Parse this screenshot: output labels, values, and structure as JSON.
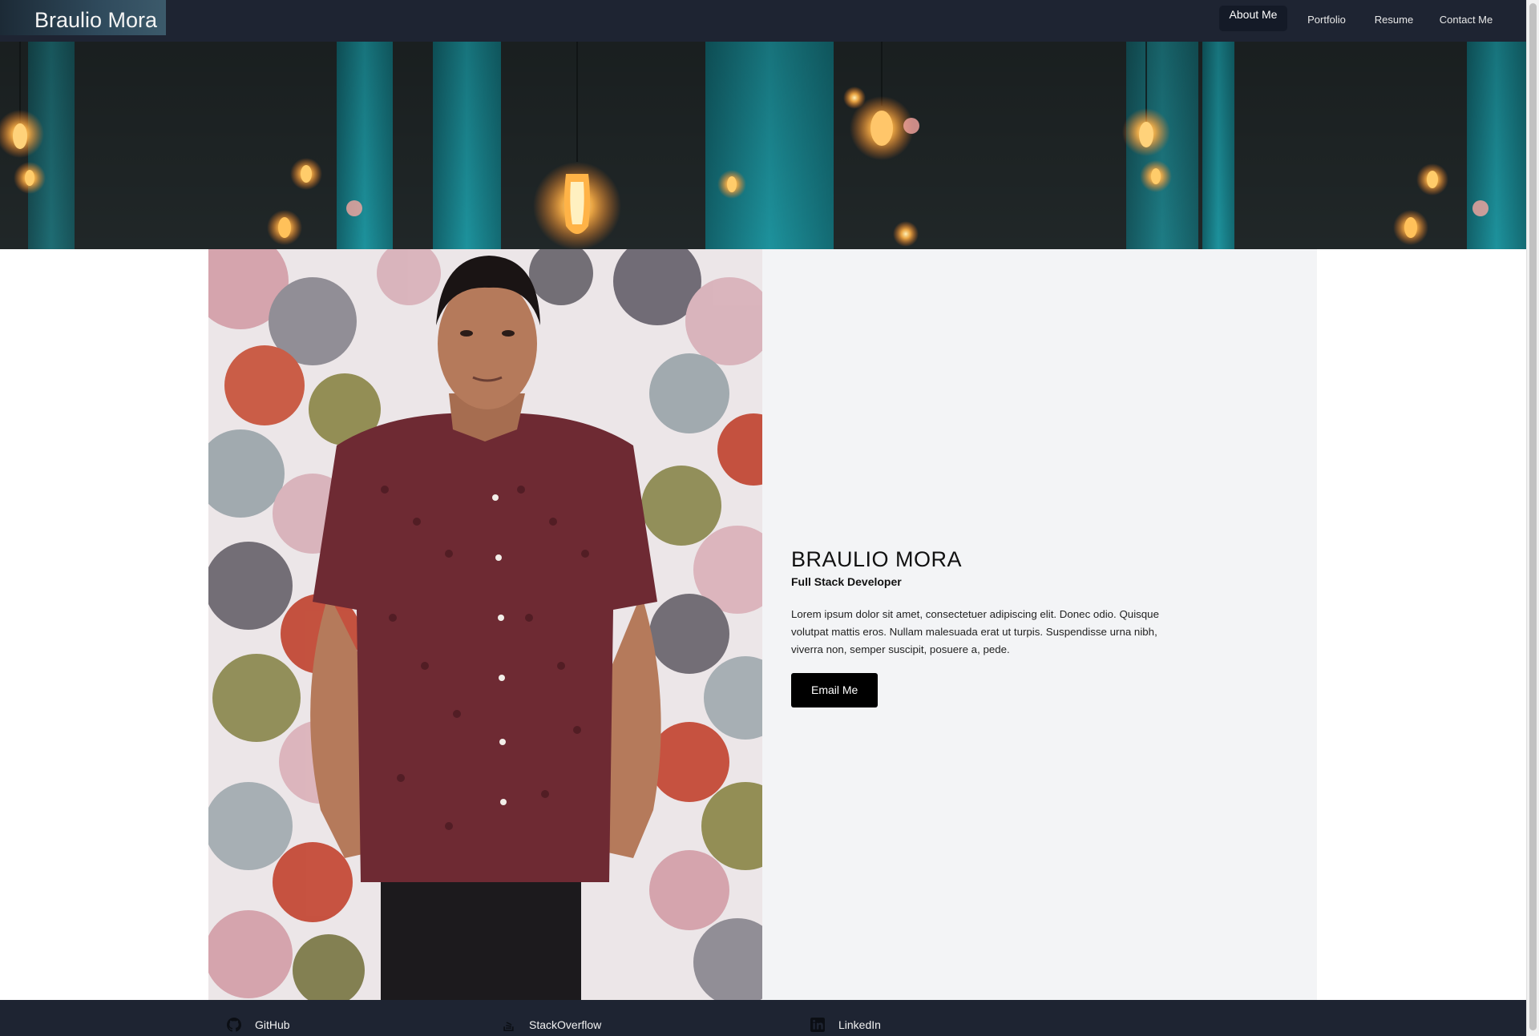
{
  "header": {
    "brand": "Braulio Mora",
    "nav": [
      {
        "label": "About Me",
        "active": true
      },
      {
        "label": "Portfolio",
        "active": false
      },
      {
        "label": "Resume",
        "active": false
      },
      {
        "label": "Contact Me",
        "active": false
      }
    ]
  },
  "about": {
    "name": "BRAULIO MORA",
    "role": "Full Stack Developer",
    "bio": "Lorem ipsum dolor sit amet, consectetuer adipiscing elit. Donec odio. Quisque volutpat mattis eros. Nullam malesuada erat ut turpis. Suspendisse urna nibh, viverra non, semper suscipit, posuere a, pede.",
    "cta_label": "Email Me"
  },
  "footer": {
    "links": [
      {
        "label": "GitHub",
        "icon": "github-icon"
      },
      {
        "label": "StackOverflow",
        "icon": "stackoverflow-icon"
      },
      {
        "label": "LinkedIn",
        "icon": "linkedin-icon"
      }
    ]
  },
  "colors": {
    "navbar": "#1e2432",
    "about_panel": "#f3f4f6",
    "button": "#000000",
    "hero_teal": "#1a8e9a"
  }
}
